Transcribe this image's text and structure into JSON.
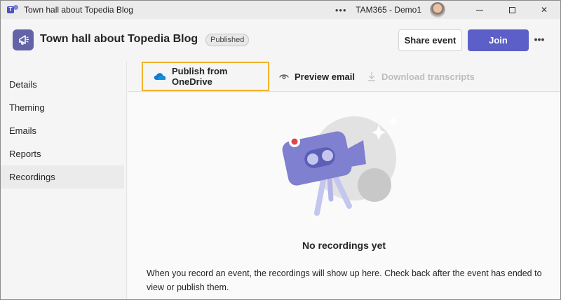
{
  "window": {
    "title": "Town hall about Topedia Blog",
    "more": "•••",
    "tenant": "TAM365 - Demo1",
    "min": "",
    "max": "",
    "close": "✕"
  },
  "header": {
    "title": "Town hall about Topedia Blog",
    "status_badge": "Published",
    "share_label": "Share event",
    "join_label": "Join",
    "more": "•••"
  },
  "sidebar": {
    "items": [
      {
        "label": "Details"
      },
      {
        "label": "Theming"
      },
      {
        "label": "Emails"
      },
      {
        "label": "Reports"
      },
      {
        "label": "Recordings",
        "active": true
      }
    ]
  },
  "toolbar": {
    "publish_label": "Publish from OneDrive",
    "preview_label": "Preview email",
    "download_label": "Download transcripts"
  },
  "main": {
    "empty_title": "No recordings yet",
    "empty_desc": "When you record an event, the recordings will show up here. Check back after the event has ended to view or publish them."
  },
  "colors": {
    "accent": "#5b5fc7",
    "highlight_border": "#f2b22e",
    "onedrive": "#0f78d4"
  }
}
